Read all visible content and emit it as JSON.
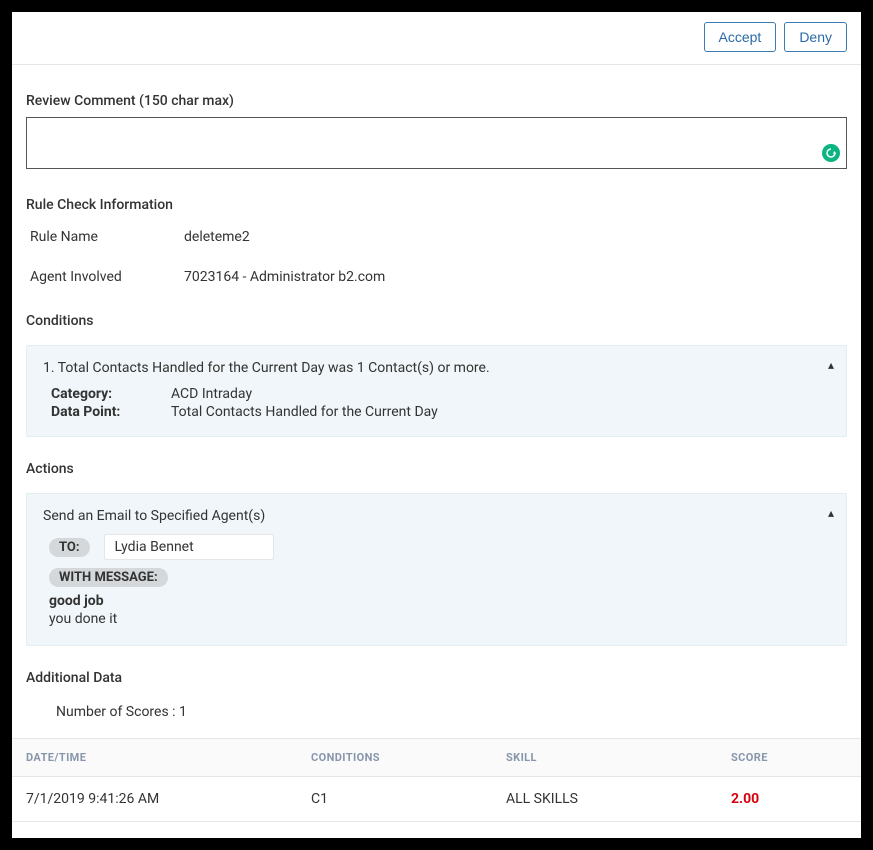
{
  "header": {
    "accept_label": "Accept",
    "deny_label": "Deny"
  },
  "review": {
    "label": "Review Comment (150 char max)",
    "value": ""
  },
  "ruleInfo": {
    "heading": "Rule Check Information",
    "rows": [
      {
        "key": "Rule Name",
        "val": "deleteme2"
      },
      {
        "key": "Agent Involved",
        "val": "7023164 - Administrator b2.com"
      }
    ]
  },
  "conditions": {
    "heading": "Conditions",
    "items": [
      {
        "title": "1. Total Contacts Handled for the Current Day was 1 Contact(s) or more.",
        "category_label": "Category:",
        "category_value": "ACD Intraday",
        "datapoint_label": "Data Point:",
        "datapoint_value": "Total Contacts Handled for the Current Day"
      }
    ]
  },
  "actions": {
    "heading": "Actions",
    "items": [
      {
        "title": "Send an Email to Specified Agent(s)",
        "to_label": "TO:",
        "to_value": "Lydia Bennet",
        "with_message_label": "WITH MESSAGE:",
        "subject": "good job",
        "body": "you done it"
      }
    ]
  },
  "additional": {
    "heading": "Additional Data",
    "scores_line": "Number of Scores : 1"
  },
  "table": {
    "columns": {
      "datetime": "DATE/TIME",
      "conditions": "CONDITIONS",
      "skill": "SKILL",
      "score": "SCORE"
    },
    "rows": [
      {
        "datetime": "7/1/2019 9:41:26 AM",
        "conditions": "C1",
        "skill": "ALL SKILLS",
        "score": "2.00"
      }
    ]
  }
}
